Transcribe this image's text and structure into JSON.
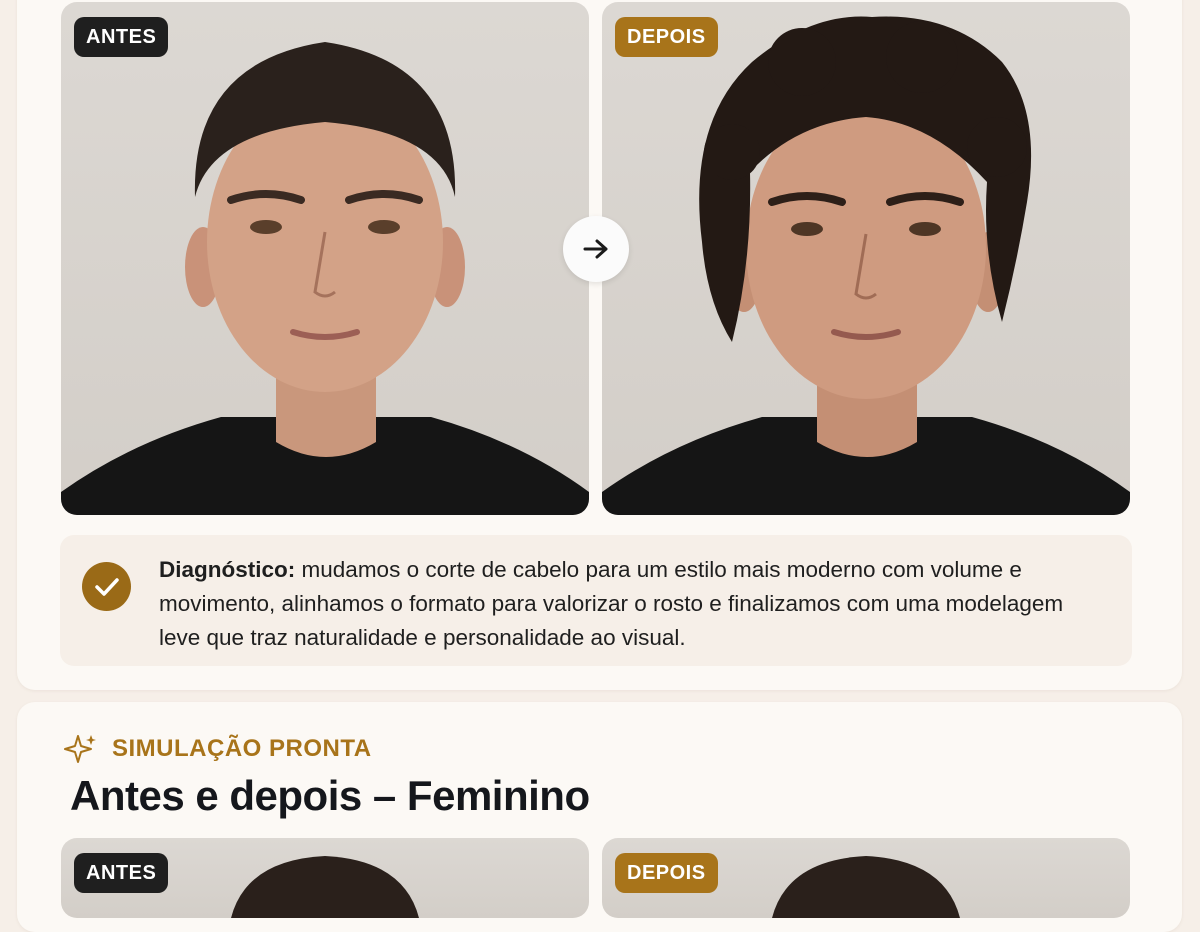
{
  "comparison_male": {
    "before_label": "ANTES",
    "after_label": "DEPOIS",
    "diagnosis": {
      "heading": "Diagnóstico:",
      "text": "mudamos o corte de cabelo para um estilo mais moderno com volume e movimento, alinhamos o formato para valorizar o rosto e finalizamos com uma modelagem leve que traz naturalidade e personalidade ao visual."
    }
  },
  "section_female": {
    "eyebrow": "SIMULAÇÃO PRONTA",
    "title": "Antes e depois – Feminino",
    "before_label": "ANTES",
    "after_label": "DEPOIS"
  },
  "icons": {
    "compare_arrow": "arrow-right-icon",
    "diagnosis": "check-circle-icon",
    "eyebrow": "sparkles-icon"
  },
  "colors": {
    "accent_gold": "#a8741a",
    "badge_dark": "#1f1f1f",
    "check_fill": "#9a6a17",
    "page_bg": "#f6efe8",
    "card_bg": "#fcf9f5"
  }
}
